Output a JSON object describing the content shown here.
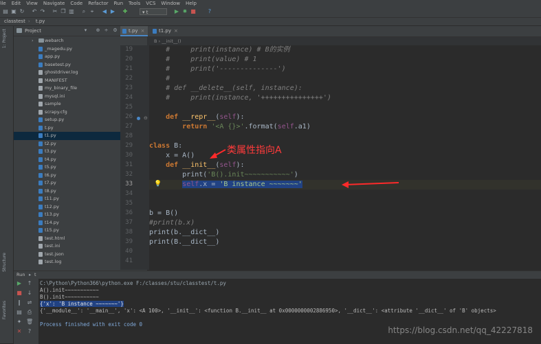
{
  "menu": [
    "File",
    "Edit",
    "View",
    "Navigate",
    "Code",
    "Refactor",
    "Run",
    "Tools",
    "VCS",
    "Window",
    "Help"
  ],
  "toolbar": {
    "icons": [
      "open-icon",
      "save-icon",
      "sync-icon",
      "undo-icon",
      "redo-icon",
      "cut-icon",
      "copy-icon",
      "paste-icon",
      "find-icon",
      "replace-icon",
      "back-icon",
      "forward-icon",
      "build-icon"
    ],
    "run_config": "t",
    "actions": [
      "run-icon",
      "debug-icon",
      "stop-icon",
      "help-icon"
    ]
  },
  "breadcrumb": [
    "classtest",
    "t.py"
  ],
  "project": {
    "title": "Project",
    "tree": [
      {
        "label": "webarch",
        "type": "folder"
      },
      {
        "label": "_magedu.py",
        "type": "py"
      },
      {
        "label": "app.py",
        "type": "py"
      },
      {
        "label": "basetest.py",
        "type": "py"
      },
      {
        "label": "ghostdriver.log",
        "type": "file"
      },
      {
        "label": "MANIFEST",
        "type": "file"
      },
      {
        "label": "my_binary_file",
        "type": "file"
      },
      {
        "label": "mysql.ini",
        "type": "file"
      },
      {
        "label": "sample",
        "type": "file"
      },
      {
        "label": "scrapy.cfg",
        "type": "file"
      },
      {
        "label": "setup.py",
        "type": "py"
      },
      {
        "label": "t.py",
        "type": "py"
      },
      {
        "label": "t1.py",
        "type": "py"
      },
      {
        "label": "t2.py",
        "type": "py"
      },
      {
        "label": "t3.py",
        "type": "py"
      },
      {
        "label": "t4.py",
        "type": "py"
      },
      {
        "label": "t5.py",
        "type": "py"
      },
      {
        "label": "t6.py",
        "type": "py"
      },
      {
        "label": "t7.py",
        "type": "py"
      },
      {
        "label": "t8.py",
        "type": "py"
      },
      {
        "label": "t11.py",
        "type": "py"
      },
      {
        "label": "t12.py",
        "type": "py"
      },
      {
        "label": "t13.py",
        "type": "py"
      },
      {
        "label": "t14.py",
        "type": "py"
      },
      {
        "label": "t15.py",
        "type": "py"
      },
      {
        "label": "test.html",
        "type": "file"
      },
      {
        "label": "test.ini",
        "type": "file"
      },
      {
        "label": "test.json",
        "type": "file"
      },
      {
        "label": "test.log",
        "type": "file"
      }
    ],
    "selected_index": 12
  },
  "tabs": [
    {
      "label": "t.py",
      "active": true
    },
    {
      "label": "t1.py",
      "active": false
    }
  ],
  "editor_crumb": "B  ›  __init__()",
  "editor": {
    "line_numbers": [
      19,
      20,
      21,
      22,
      23,
      24,
      25,
      26,
      27,
      28,
      29,
      30,
      31,
      32,
      33,
      34,
      35,
      36,
      37,
      38,
      39,
      40,
      41
    ],
    "current_line": 33
  },
  "annotation": "类属性指向A",
  "run": {
    "title": "Run",
    "tab": "t",
    "lines": [
      "C:\\Python\\Python366\\python.exe F:/classes/stu/classtest/t.py",
      "A().init~~~~~~~~~~~",
      "B().init~~~~~~~~~~~",
      "{'x': 'B instance ~~~~~~~'}",
      "{'__module__': '__main__', 'x': <A 100>, '__init__': <function B.__init__ at 0x0000000002886950>, '__dict__': <attribute '__dict__' of 'B' objects>",
      "",
      "Process finished with exit code 0"
    ]
  },
  "watermark": "https://blog.csdn.net/qq_42227818"
}
